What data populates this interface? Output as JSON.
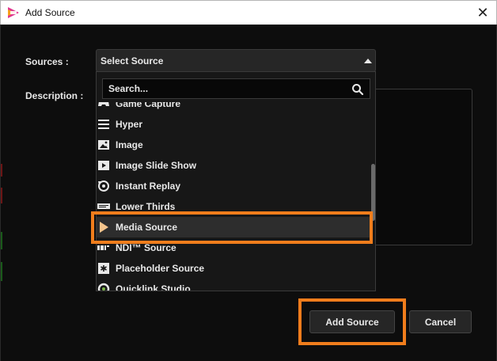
{
  "window": {
    "title": "Add Source",
    "close_glyph": "✕"
  },
  "form": {
    "sources_label": "Sources :",
    "description_label": "Description :",
    "select_value": "Select Source"
  },
  "dropdown": {
    "search_placeholder": "Search...",
    "items": [
      {
        "label": "Game Capture",
        "icon": "gamepad-icon"
      },
      {
        "label": "Hyper",
        "icon": "menu-lines-icon"
      },
      {
        "label": "Image",
        "icon": "image-icon"
      },
      {
        "label": "Image Slide Show",
        "icon": "slideshow-icon"
      },
      {
        "label": "Instant Replay",
        "icon": "replay-icon"
      },
      {
        "label": "Lower Thirds",
        "icon": "lower-thirds-icon"
      },
      {
        "label": "Media Source",
        "icon": "play-triangle-icon"
      },
      {
        "label": "NDI™ Source",
        "icon": "ndi-icon"
      },
      {
        "label": "Placeholder Source",
        "icon": "asterisk-icon"
      },
      {
        "label": "Quicklink Studio",
        "icon": "quicklink-icon"
      }
    ],
    "selected": "Media Source"
  },
  "buttons": {
    "add_source": "Add Source",
    "cancel": "Cancel"
  },
  "colors": {
    "highlight": "#f07d1c",
    "background": "#0d0d0d",
    "text": "#e8e8e8"
  }
}
